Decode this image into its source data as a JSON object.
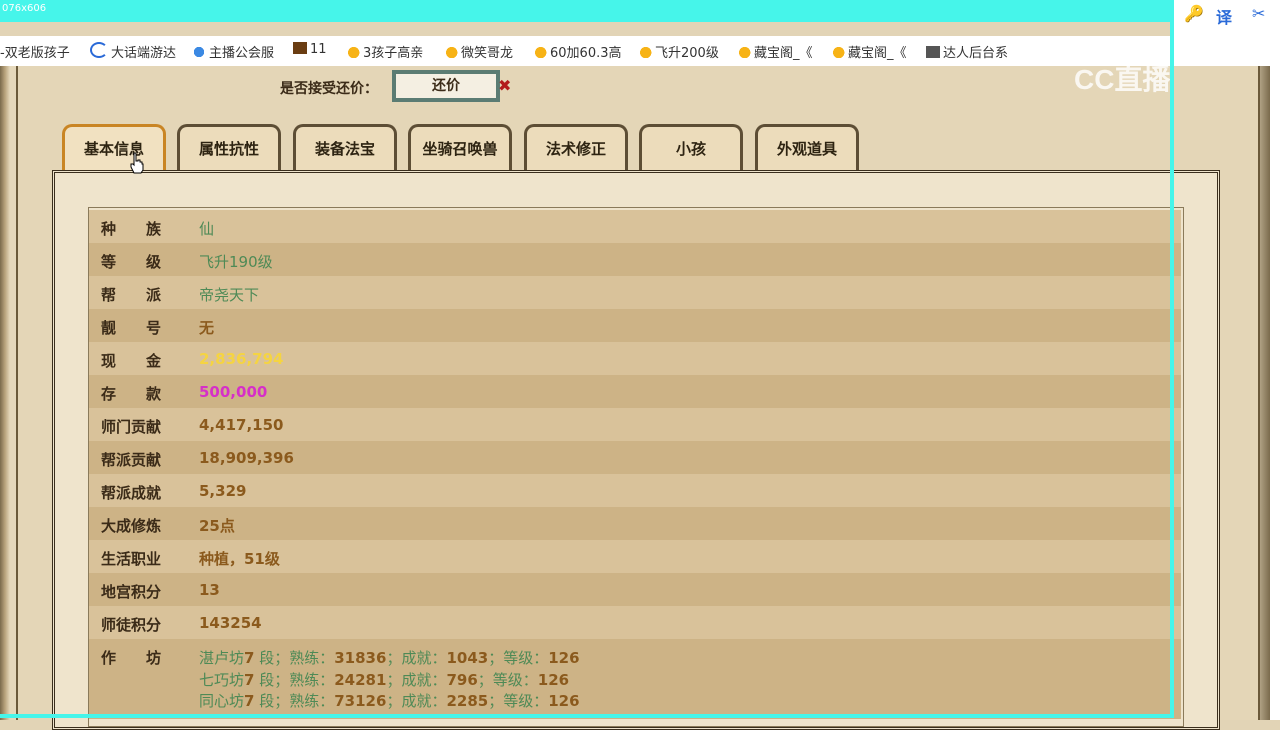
{
  "capture": {
    "dimensions": "076x606"
  },
  "bookmarks": [
    {
      "label": "双老版孩子",
      "icon": "none"
    },
    {
      "label": "大话端游达",
      "icon": "c-icon"
    },
    {
      "label": "主播公会服",
      "icon": "face-icon"
    },
    {
      "label": "11",
      "icon": "game-icon"
    },
    {
      "label": "3孩子高亲",
      "icon": "chick-icon"
    },
    {
      "label": "微笑哥龙",
      "icon": "chick-icon"
    },
    {
      "label": "60加60.3高",
      "icon": "chick-icon"
    },
    {
      "label": "飞升200级",
      "icon": "chick-icon"
    },
    {
      "label": "藏宝阁_《",
      "icon": "chick-icon"
    },
    {
      "label": "藏宝阁_《",
      "icon": "chick-icon"
    },
    {
      "label": "达人后台系",
      "icon": "doc-icon"
    }
  ],
  "toolbar": {
    "key_glyph": "🔑",
    "translate_glyph": "译",
    "scissors_glyph": "✂"
  },
  "watermark": "CC直播",
  "counter_offer": {
    "label": "是否接受还价：",
    "button": "还价",
    "close": "✖"
  },
  "tabs": [
    "基本信息",
    "属性抗性",
    "装备法宝",
    "坐骑召唤兽",
    "法术修正",
    "小孩",
    "外观道具"
  ],
  "active_tab": 0,
  "info_rows": [
    {
      "label": "种　　族",
      "value": "仙",
      "style": "green"
    },
    {
      "label": "等　　级",
      "value": "飞升190级",
      "style": "green"
    },
    {
      "label": "帮　　派",
      "value": "帝尧天下",
      "style": "green"
    },
    {
      "label": "靓　　号",
      "value": "无",
      "style": "brown"
    },
    {
      "label": "现　　金",
      "value": "2,836,794",
      "style": "gold"
    },
    {
      "label": "存　　款",
      "value": "500,000",
      "style": "magenta"
    },
    {
      "label": "师门贡献",
      "value": "4,417,150",
      "style": "brown"
    },
    {
      "label": "帮派贡献",
      "value": "18,909,396",
      "style": "brown"
    },
    {
      "label": "帮派成就",
      "value": "5,329",
      "style": "brown"
    },
    {
      "label": "大成修炼",
      "value": "25点",
      "style": "brown"
    },
    {
      "label": "生活职业",
      "value": "种植，51级",
      "style": "brown"
    },
    {
      "label": "地宫积分",
      "value": "13",
      "style": "brown"
    },
    {
      "label": "师徒积分",
      "value": "143254",
      "style": "brown"
    }
  ],
  "workshop": {
    "label": "作　　坊",
    "lines": [
      {
        "name": "湛卢坊",
        "dan": "7",
        "dan_unit": "段；熟练：",
        "skill": "31836",
        "ach_label": "；成就：",
        "ach": "1043",
        "lvl_label": "；等级：",
        "lvl": "126"
      },
      {
        "name": "七巧坊",
        "dan": "7",
        "dan_unit": "段；熟练：",
        "skill": "24281",
        "ach_label": "；成就：",
        "ach": "796",
        "lvl_label": "；等级：",
        "lvl": "126"
      },
      {
        "name": "同心坊",
        "dan": "7",
        "dan_unit": "段；熟练：",
        "skill": "73126",
        "ach_label": "；成就：",
        "ach": "2285",
        "lvl_label": "；等级：",
        "lvl": "126"
      }
    ]
  }
}
